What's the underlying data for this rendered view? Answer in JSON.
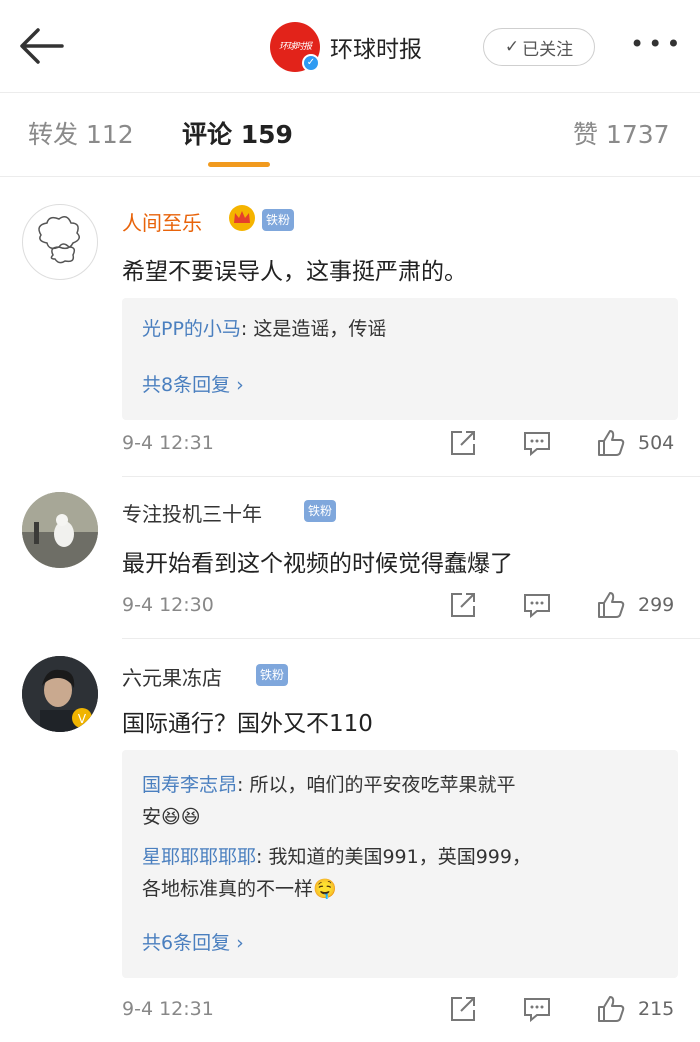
{
  "header": {
    "account_name": "环球时报",
    "logo_text": "环球时报",
    "follow_label": "已关注",
    "more_label": "•••"
  },
  "tabs": [
    {
      "label": "转发",
      "count": "112"
    },
    {
      "label": "评论",
      "count": "159",
      "active": true
    },
    {
      "label": "赞",
      "count": "1737"
    }
  ],
  "colors": {
    "accent_tab": "#f19a1e",
    "link_blue": "#4a7fbf",
    "badge_blue": "#7fa7dc",
    "brand_red": "#e2231a",
    "vip_name": "#e8630a"
  },
  "comments": [
    {
      "username": "人间至乐",
      "username_color": "#e8630a",
      "crown": true,
      "badge": "铁粉",
      "text": "希望不要误导人，这事挺严肃的。",
      "replies": [
        {
          "author": "光PP的小马",
          "text": ": 这是造谣，传谣"
        }
      ],
      "reply_more": "共8条回复 ›",
      "time": "9-4 12:31",
      "likes": "504"
    },
    {
      "username": "专注投机三十年",
      "username_color": "#333333",
      "badge": "铁粉",
      "text": "最开始看到这个视频的时候觉得蠢爆了",
      "time": "9-4 12:30",
      "likes": "299"
    },
    {
      "username": "六元果冻店",
      "username_color": "#333333",
      "badge": "铁粉",
      "text": "国际通行？国外又不110",
      "replies": [
        {
          "author": "国寿李志昂",
          "text": ": 所以，咱们的平安夜吃苹果就平",
          "text2": "安😆😆"
        },
        {
          "author": "星耶耶耶耶耶",
          "text": ": 我知道的美国991，英国999，",
          "text2": "各地标准真的不一样🤤"
        }
      ],
      "reply_more": "共6条回复 ›",
      "time": "9-4 12:31",
      "likes": "215"
    }
  ]
}
